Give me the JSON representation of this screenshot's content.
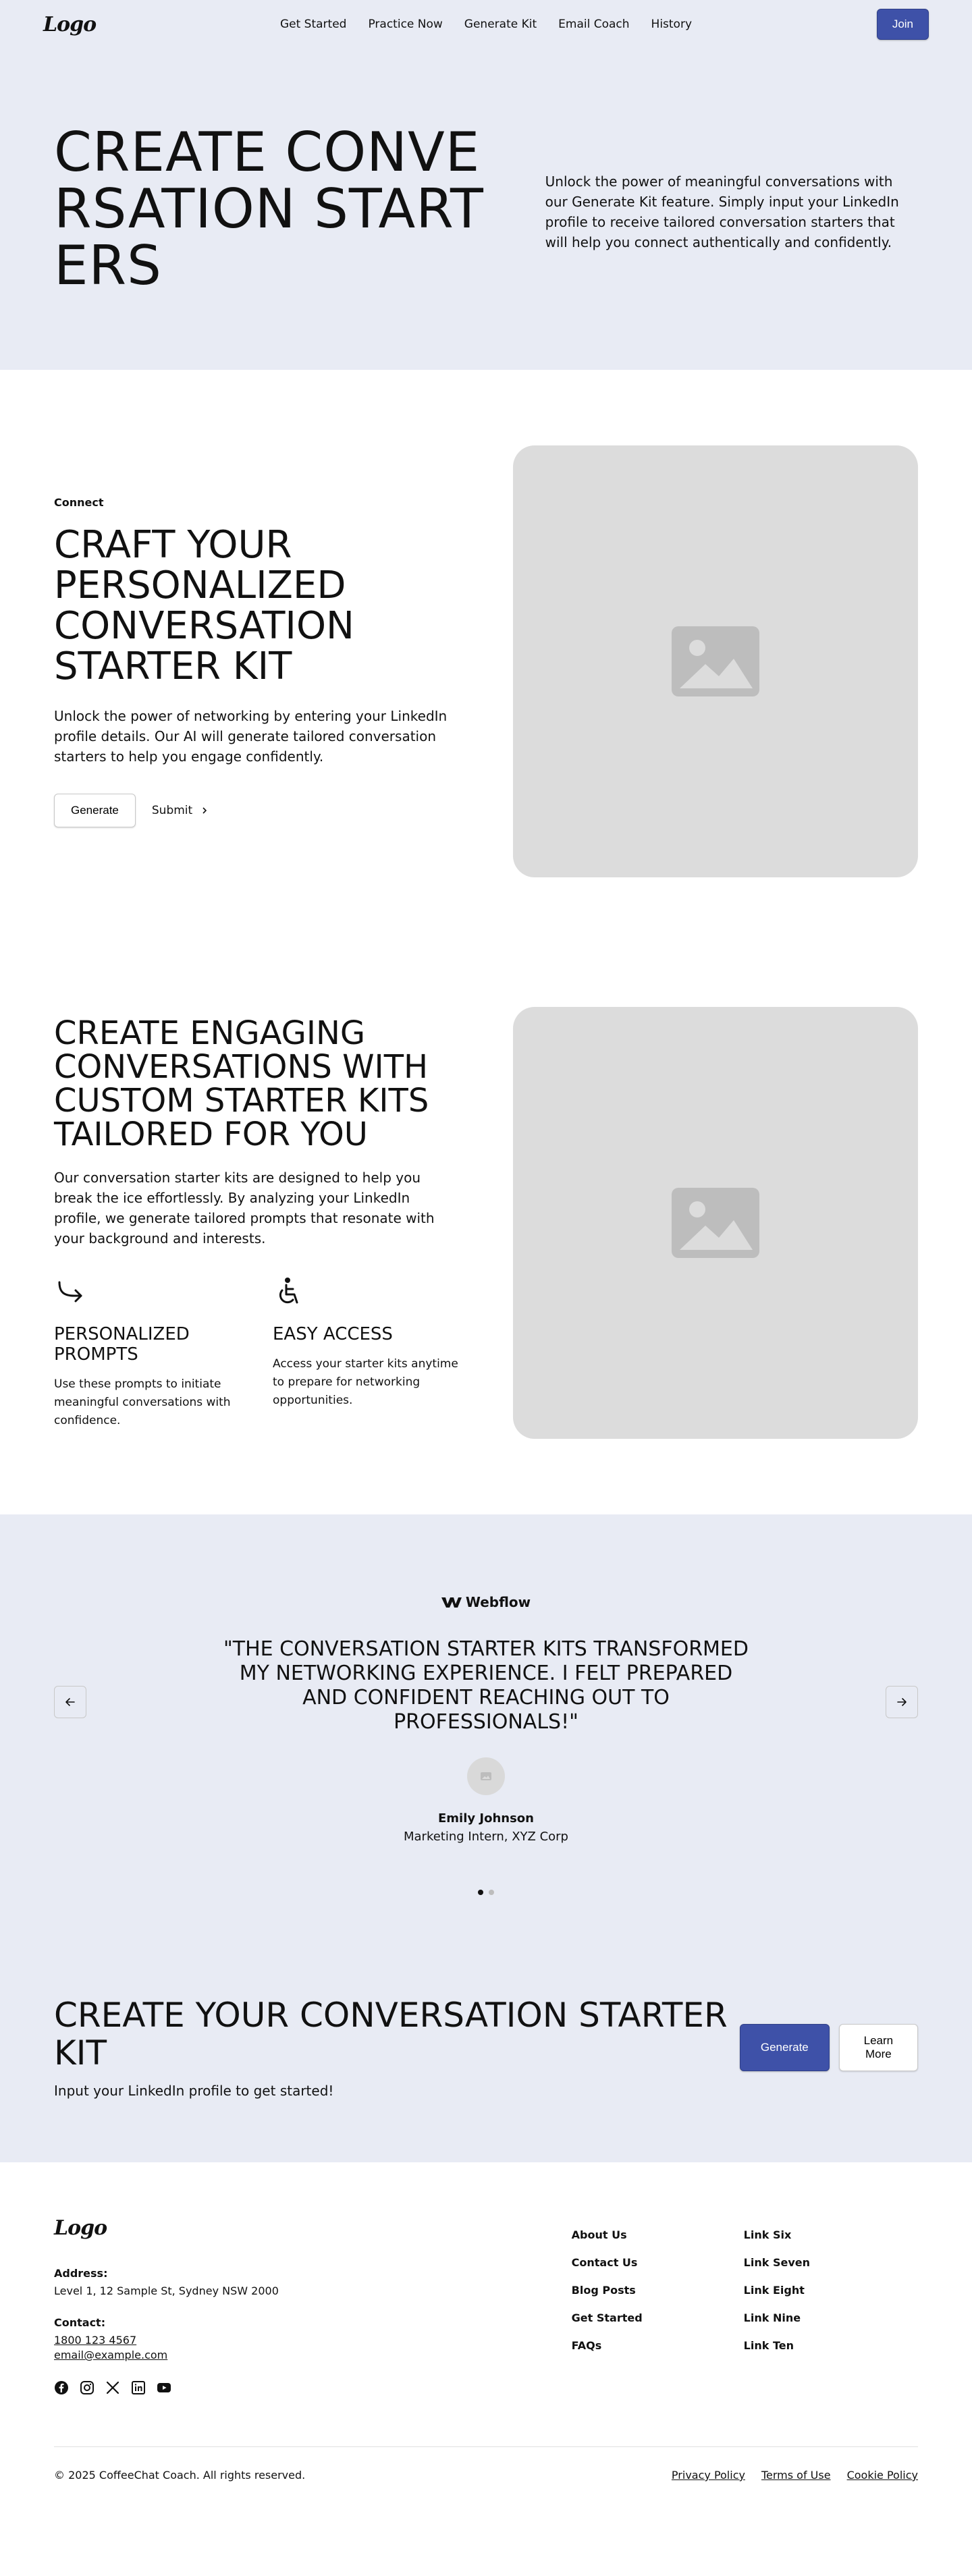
{
  "nav": {
    "logo": "Logo",
    "links": [
      "Get Started",
      "Practice Now",
      "Generate Kit",
      "Email Coach",
      "History"
    ],
    "join": "Join"
  },
  "hero": {
    "title": "CREATE CONVERSATION STARTERS",
    "text": "Unlock the power of meaningful conversations with our Generate Kit feature. Simply input your LinkedIn profile to receive tailored conversation starters that will help you connect authentically and confidently."
  },
  "section1": {
    "tagline": "Connect",
    "title": "CRAFT YOUR PERSONALIZED CONVERSATION STARTER KIT",
    "text": "Unlock the power of networking by entering your LinkedIn profile details. Our AI will generate tailored conversation starters to help you engage confidently.",
    "primary": "Generate",
    "secondary": "Submit"
  },
  "section2": {
    "title": "CREATE ENGAGING CONVERSATIONS WITH CUSTOM STARTER KITS TAILORED FOR YOU",
    "text": "Our conversation starter kits are designed to help you break the ice effortlessly. By analyzing your LinkedIn profile, we generate tailored prompts that resonate with your background and interests.",
    "features": [
      {
        "icon": "arrow-redirect-icon",
        "title": "PERSONALIZED PROMPTS",
        "text": "Use these prompts to initiate meaningful conversations with confidence."
      },
      {
        "icon": "accessibility-icon",
        "title": "EASY ACCESS",
        "text": "Access your starter kits anytime to prepare for networking opportunities."
      }
    ]
  },
  "testimonial": {
    "brand": "Webflow",
    "quote": "\"THE CONVERSATION STARTER KITS TRANSFORMED MY NETWORKING EXPERIENCE. I FELT PREPARED AND CONFIDENT REACHING OUT TO PROFESSIONALS!\"",
    "name": "Emily Johnson",
    "role": "Marketing Intern, XYZ Corp",
    "slides": 2,
    "active_slide": 1
  },
  "cta": {
    "title": "CREATE YOUR CONVERSATION STARTER KIT",
    "subtitle": "Input your LinkedIn profile to get started!",
    "primary": "Generate",
    "secondary": "Learn More"
  },
  "footer": {
    "logo": "Logo",
    "address_label": "Address:",
    "address": "Level 1, 12 Sample St, Sydney NSW 2000",
    "contact_label": "Contact:",
    "phone": "1800 123 4567",
    "email": "email@example.com",
    "socials": [
      "facebook-icon",
      "instagram-icon",
      "x-icon",
      "linkedin-icon",
      "youtube-icon"
    ],
    "col1": [
      "About Us",
      "Contact Us",
      "Blog Posts",
      "Get Started",
      "FAQs"
    ],
    "col2": [
      "Link Six",
      "Link Seven",
      "Link Eight",
      "Link Nine",
      "Link Ten"
    ],
    "copyright": "© 2025 CoffeeChat Coach. All rights reserved.",
    "legal": [
      "Privacy Policy",
      "Terms of Use",
      "Cookie Policy"
    ]
  },
  "colors": {
    "accent": "#3e51a8",
    "section_bg": "#e8ebf4",
    "placeholder": "#dcdcdc"
  }
}
